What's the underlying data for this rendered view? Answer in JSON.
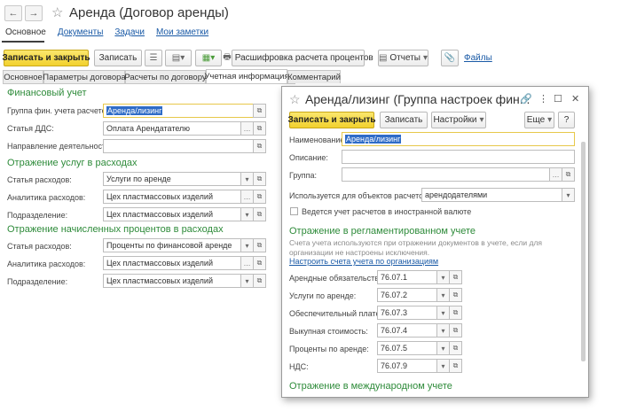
{
  "window": {
    "title": "Аренда (Договор аренды)",
    "back_icon": "←",
    "forward_icon": "→",
    "star_icon": "☆"
  },
  "nav_links": [
    "Основное",
    "Документы",
    "Задачи",
    "Мои заметки"
  ],
  "toolbar": {
    "save_close": "Записать и закрыть",
    "save": "Записать",
    "interest": "Расшифровка расчета процентов",
    "reports": "Отчеты",
    "files": "Файлы"
  },
  "tabs": [
    "Основное",
    "Параметры договора",
    "Расчеты по договору",
    "Учетная информация",
    "Комментарий"
  ],
  "form": {
    "fin": {
      "header": "Финансовый учет",
      "group_label": "Группа фин. учета расчетов:",
      "group_value": "Аренда/лизинг",
      "dds_label": "Статья ДДС:",
      "dds_value": "Оплата Арендатателю",
      "direction_label": "Направление деятельности:",
      "direction_value": ""
    },
    "services": {
      "header": "Отражение услуг в расходах",
      "article_label": "Статья расходов:",
      "article_value": "Услуги по аренде",
      "analytics_label": "Аналитика расходов:",
      "analytics_value": "Цех пластмассовых изделий",
      "division_label": "Подразделение:",
      "division_value": "Цех пластмассовых изделий"
    },
    "interest": {
      "header": "Отражение начисленных процентов в расходах",
      "article_label": "Статья расходов:",
      "article_value": "Проценты по финансовой аренде",
      "analytics_label": "Аналитика расходов:",
      "analytics_value": "Цех пластмассовых изделий",
      "division_label": "Подразделение:",
      "division_value": "Цех пластмассовых изделий"
    }
  },
  "dialog": {
    "title": "Аренда/лизинг (Группа настроек фин...",
    "save_close": "Записать и закрыть",
    "save": "Записать",
    "settings": "Настройки",
    "more": "Еще",
    "help": "?",
    "name_label": "Наименование:",
    "name_value": "Аренда/лизинг",
    "desc_label": "Описание:",
    "group_label": "Группа:",
    "used_label": "Используется для объектов расчетов с:",
    "used_value": "арендодателями",
    "currency_check": "Ведется учет расчетов в иностранной валюте",
    "reg_header": "Отражение в регламентированном учете",
    "reg_note": "Счета учета используются при отражении документов в учете, если для организации не настроены исключения.",
    "reg_link": "Настроить счета учета по организациям",
    "accounts": [
      {
        "label": "Арендные обязательства:",
        "value": "76.07.1"
      },
      {
        "label": "Услуги по аренде:",
        "value": "76.07.2"
      },
      {
        "label": "Обеспечительный платеж:",
        "value": "76.07.3"
      },
      {
        "label": "Выкупная стоимость:",
        "value": "76.07.4"
      },
      {
        "label": "Проценты по аренде:",
        "value": "76.07.5"
      },
      {
        "label": "НДС:",
        "value": "76.07.9"
      }
    ],
    "intl_header": "Отражение в международном учете"
  }
}
